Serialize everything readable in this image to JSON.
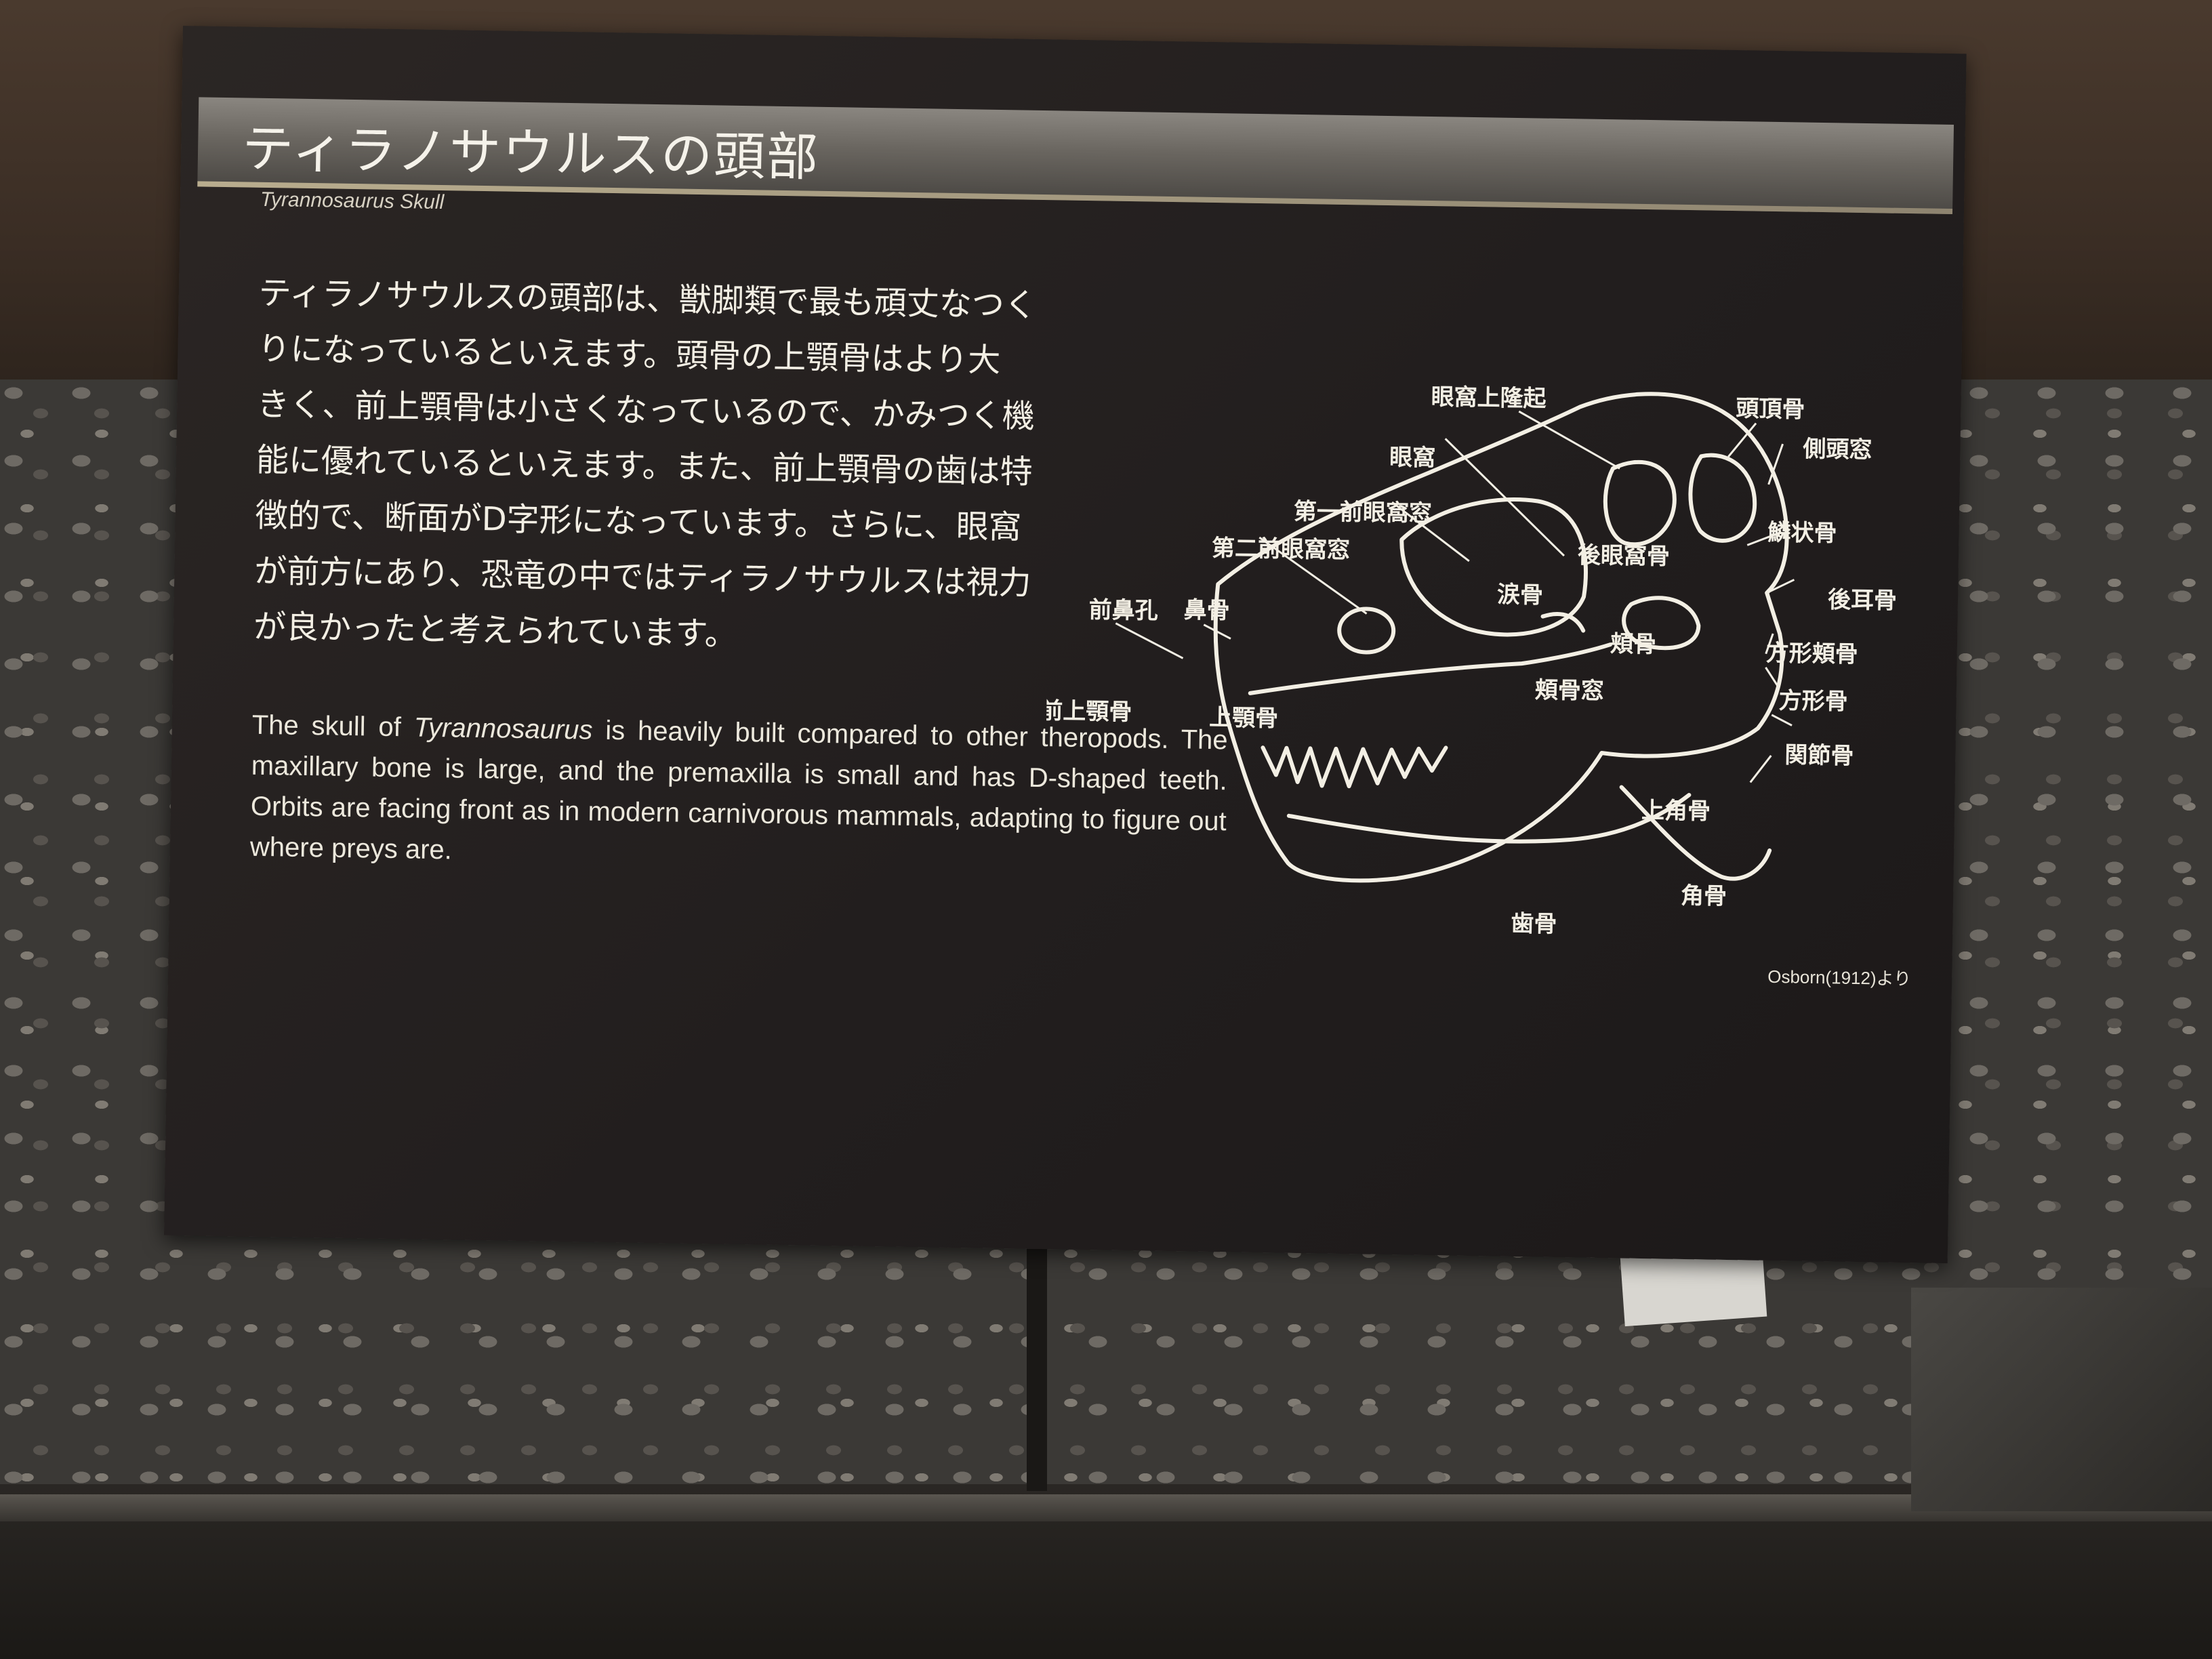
{
  "panel": {
    "title_ja": "ティラノサウルスの頭部",
    "subtitle_en": "Tyrannosaurus Skull",
    "body_ja": [
      "ティラノサウルスの頭部は、獣脚類で最も頑丈なつく",
      "りになっているといえます。頭骨の上顎骨はより大",
      "きく、前上顎骨は小さくなっているので、かみつく機",
      "能に優れているといえます。また、前上顎骨の歯は特",
      "徴的で、断面がD字形になっています。さらに、眼窩",
      "が前方にあり、恐竜の中ではティラノサウルスは視力",
      "が良かったと考えられています。"
    ],
    "body_en_before": "The skull of ",
    "body_en_italic": "Tyrannosaurus",
    "body_en_after": " is heavily built compared to other theropods.  The maxillary bone is large, and the premaxilla is small and has D-shaped teeth.  Orbits are facing front as in modern carnivorous mammals, adapting to figure out where preys are."
  },
  "diagram": {
    "labels": {
      "postorbital_crest": "眼窩上隆起",
      "orbit": "眼窩",
      "first_antorbital": "第一前眼窩窓",
      "second_antorbital": "第二前眼窩窓",
      "external_naris": "前鼻孔",
      "nasal": "鼻骨",
      "premaxilla": "前上顎骨",
      "maxilla": "上顎骨",
      "lacrimal": "涙骨",
      "postorbital": "後眼窩骨",
      "jugal": "頬骨",
      "jugal_fenestra": "頬骨窓",
      "parietal": "頭頂骨",
      "temporal_fenestra": "側頭窓",
      "squamosal": "鱗状骨",
      "paroccipital": "後耳骨",
      "quadratojugal": "方形頬骨",
      "quadrate": "方形骨",
      "articular": "関節骨",
      "surangular": "上角骨",
      "angular": "角骨",
      "dentary": "歯骨"
    },
    "credit": "Osborn(1912)より"
  }
}
